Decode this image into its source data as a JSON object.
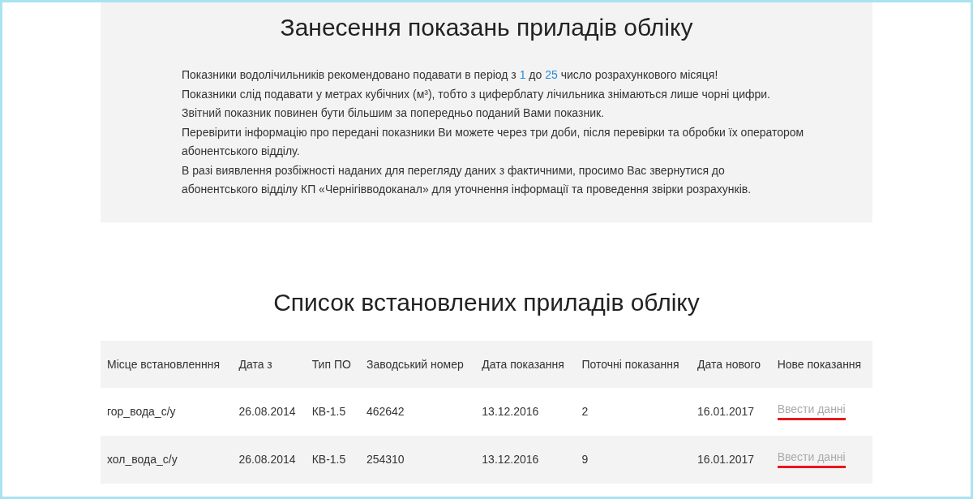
{
  "intro": {
    "title": "Занесення показань приладів обліку",
    "lines": [
      [
        {
          "text": "Показники водолічильників рекомендовано подавати в період з ",
          "highlight": false
        },
        {
          "text": "1",
          "highlight": true
        },
        {
          "text": " до ",
          "highlight": false
        },
        {
          "text": "25",
          "highlight": true
        },
        {
          "text": " число розрахункового місяця!",
          "highlight": false
        }
      ],
      [
        {
          "text": "Показники слід подавати у метрах кубічних (м³), тобто з циферблату лічильника знімаються лише чорні цифри.",
          "highlight": false
        }
      ],
      [
        {
          "text": "Звітний показник повинен бути більшим за попередньо поданий Вами показник.",
          "highlight": false
        }
      ],
      [
        {
          "text": "Перевірити інформацію про передані показники Ви можете через три доби, після перевірки та обробки їх оператором",
          "highlight": false
        }
      ],
      [
        {
          "text": "абонентського відділу.",
          "highlight": false
        }
      ],
      [
        {
          "text": "В разі виявлення розбіжності наданих для перегляду даних з фактичними, просимо Вас звернутися до",
          "highlight": false
        }
      ],
      [
        {
          "text": "абонентського відділу КП «Чернігівводоканал» для уточнення інформації та проведення звірки розрахунків.",
          "highlight": false
        }
      ]
    ]
  },
  "meters": {
    "title": "Список встановлених приладів обліку",
    "columns": [
      "Місце встановленння",
      "Дата з",
      "Тип ПО",
      "Заводський номер",
      "Дата показання",
      "Поточні показання",
      "Дата нового",
      "Нове показання"
    ],
    "rows": [
      {
        "cells": [
          "гор_вода_с/у",
          "26.08.2014",
          "КВ-1.5",
          "462642",
          "13.12.2016",
          "2",
          "16.01.2017"
        ],
        "action": "Ввести данні",
        "underlined": true
      },
      {
        "cells": [
          "хол_вода_с/у",
          "26.08.2014",
          "КВ-1.5",
          "254310",
          "13.12.2016",
          "9",
          "16.01.2017"
        ],
        "action": "Ввести данні",
        "underlined": true
      }
    ]
  }
}
